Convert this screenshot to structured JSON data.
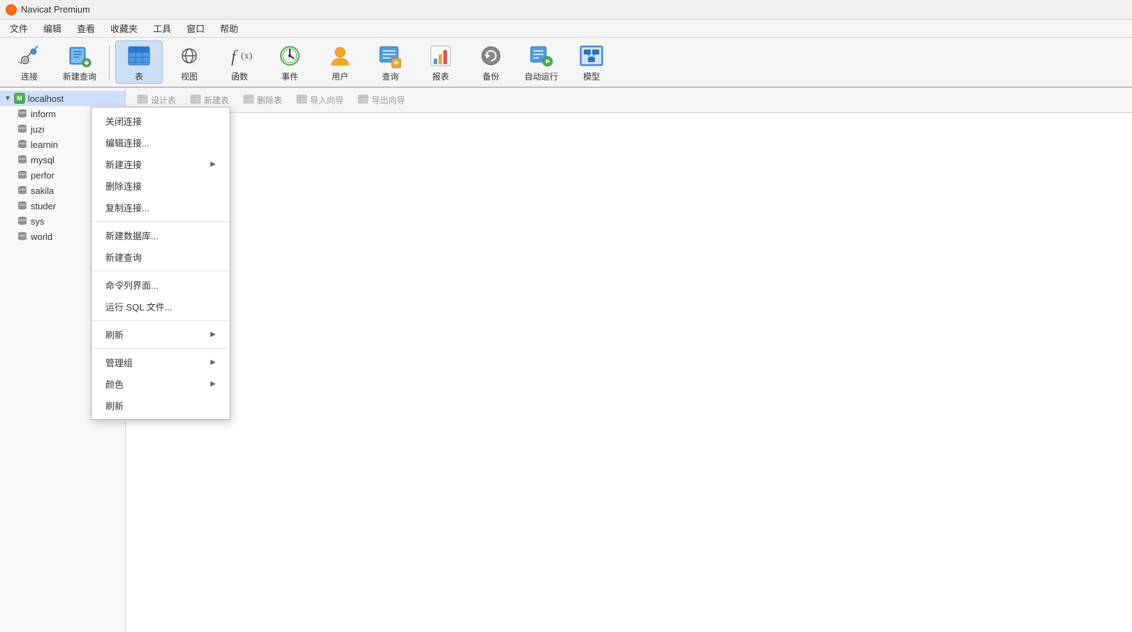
{
  "titleBar": {
    "title": "Navicat Premium"
  },
  "menuBar": {
    "items": [
      "文件",
      "编辑",
      "查看",
      "收藏夹",
      "工具",
      "窗口",
      "帮助"
    ]
  },
  "toolbar": {
    "buttons": [
      {
        "id": "connect",
        "label": "连接",
        "icon": "connect"
      },
      {
        "id": "new-query",
        "label": "新建查询",
        "icon": "new-query"
      },
      {
        "id": "table",
        "label": "表",
        "icon": "table",
        "active": true
      },
      {
        "id": "view",
        "label": "视图",
        "icon": "view"
      },
      {
        "id": "function",
        "label": "函数",
        "icon": "function"
      },
      {
        "id": "event",
        "label": "事件",
        "icon": "event"
      },
      {
        "id": "user",
        "label": "用户",
        "icon": "user"
      },
      {
        "id": "query",
        "label": "查询",
        "icon": "query"
      },
      {
        "id": "report",
        "label": "报表",
        "icon": "report"
      },
      {
        "id": "backup",
        "label": "备份",
        "icon": "backup"
      },
      {
        "id": "auto-run",
        "label": "自动运行",
        "icon": "auto-run"
      },
      {
        "id": "model",
        "label": "模型",
        "icon": "model"
      }
    ]
  },
  "sidebar": {
    "connection": {
      "name": "localhost",
      "expanded": true
    },
    "databases": [
      {
        "name": "inform"
      },
      {
        "name": "juzi"
      },
      {
        "name": "learnin"
      },
      {
        "name": "mysql"
      },
      {
        "name": "perfor"
      },
      {
        "name": "sakila"
      },
      {
        "name": "studer"
      },
      {
        "name": "sys"
      },
      {
        "name": "world"
      }
    ]
  },
  "secondaryToolbar": {
    "buttons": [
      {
        "id": "design-table",
        "label": "设计表"
      },
      {
        "id": "new-table",
        "label": "新建表"
      },
      {
        "id": "delete-table",
        "label": "删除表"
      },
      {
        "id": "import-wizard",
        "label": "导入向导"
      },
      {
        "id": "export-wizard",
        "label": "导出向导"
      }
    ]
  },
  "contextMenu": {
    "items": [
      {
        "id": "close-conn",
        "label": "关闭连接",
        "hasArrow": false,
        "separator": false
      },
      {
        "id": "edit-conn",
        "label": "编辑连接...",
        "hasArrow": false,
        "separator": false
      },
      {
        "id": "new-conn",
        "label": "新建连接",
        "hasArrow": true,
        "separator": false
      },
      {
        "id": "delete-conn",
        "label": "删除连接",
        "hasArrow": false,
        "separator": false
      },
      {
        "id": "copy-conn",
        "label": "复制连接...",
        "hasArrow": false,
        "separator": true
      },
      {
        "id": "new-db",
        "label": "新建数据库...",
        "hasArrow": false,
        "separator": false
      },
      {
        "id": "new-query",
        "label": "新建查询",
        "hasArrow": false,
        "separator": true
      },
      {
        "id": "command-line",
        "label": "命令列界面...",
        "hasArrow": false,
        "separator": false
      },
      {
        "id": "run-sql",
        "label": "运行 SQL 文件...",
        "hasArrow": false,
        "separator": true
      },
      {
        "id": "refresh",
        "label": "刷新",
        "hasArrow": true,
        "separator": false
      },
      {
        "id": "sep2",
        "label": "",
        "hasArrow": false,
        "separator": true
      },
      {
        "id": "manage-group",
        "label": "管理组",
        "hasArrow": true,
        "separator": false
      },
      {
        "id": "color",
        "label": "颜色",
        "hasArrow": true,
        "separator": false
      },
      {
        "id": "refresh2",
        "label": "刷新",
        "hasArrow": false,
        "separator": false
      }
    ]
  }
}
